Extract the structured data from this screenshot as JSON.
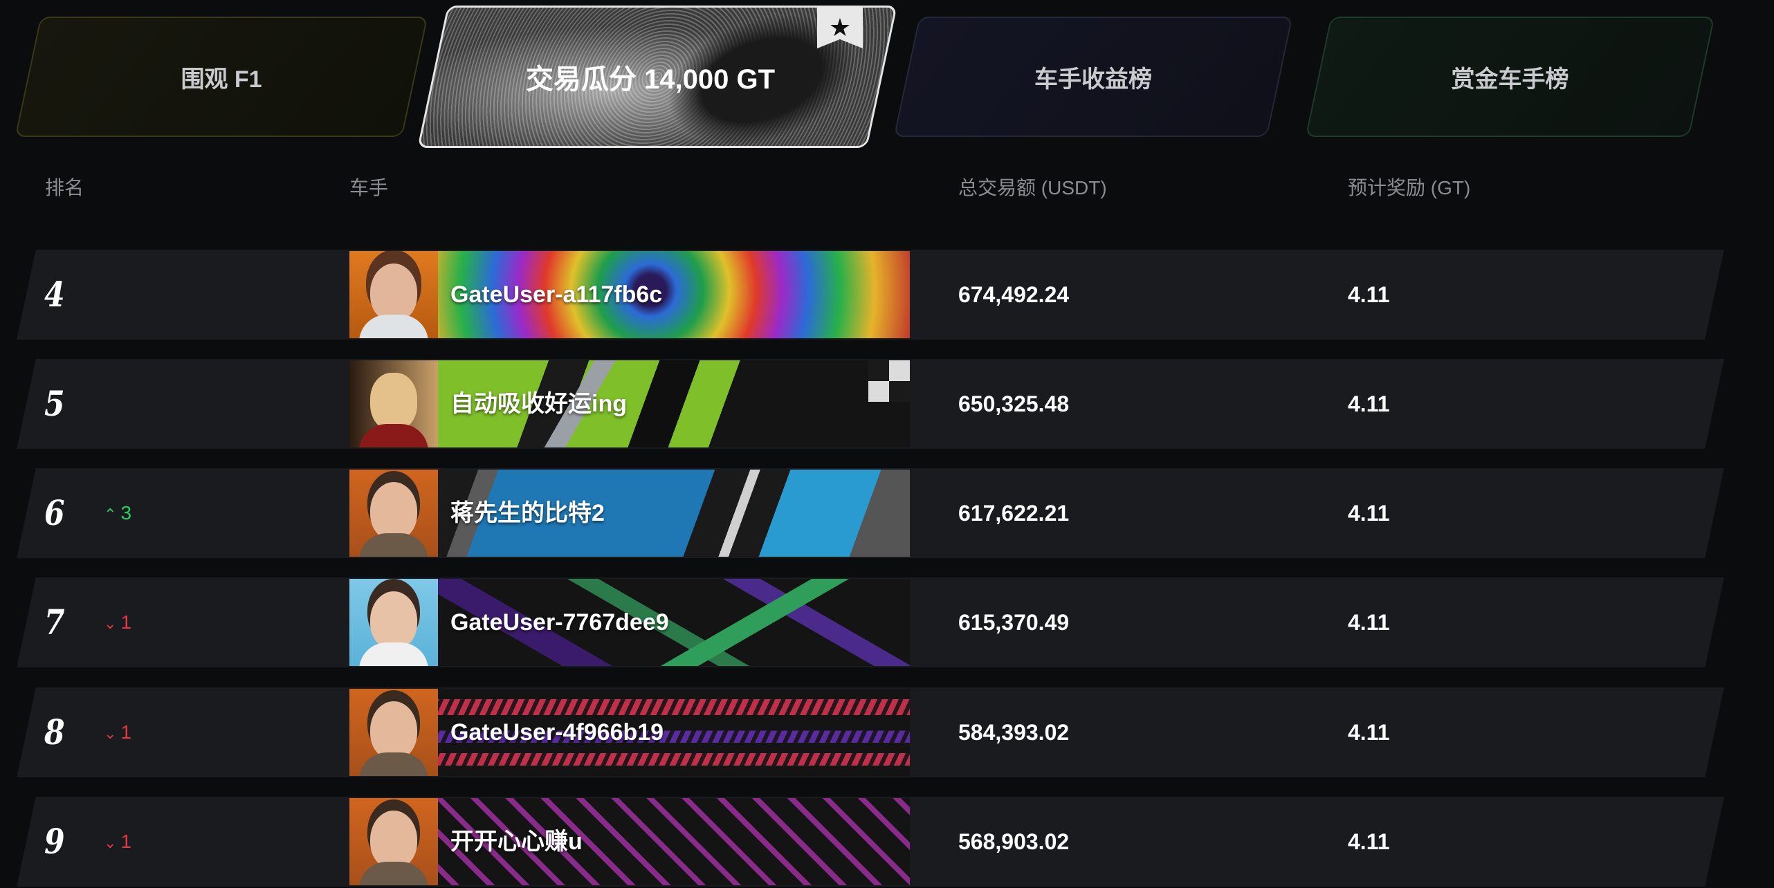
{
  "tabs": [
    {
      "label": "围观 F1"
    },
    {
      "label": "交易瓜分 14,000 GT"
    },
    {
      "label": "车手收益榜"
    },
    {
      "label": "赏金车手榜"
    }
  ],
  "header": {
    "rank": "排名",
    "driver": "车手",
    "total_volume": "总交易额 (USDT)",
    "reward": "预计奖励 (GT)"
  },
  "rows": [
    {
      "rank": "4",
      "change": "",
      "name": "GateUser-a117fb6c",
      "amount": "674,492.24",
      "reward": "4.11"
    },
    {
      "rank": "5",
      "change": "",
      "name": "自动吸收好运ing",
      "amount": "650,325.48",
      "reward": "4.11"
    },
    {
      "rank": "6",
      "change": "3",
      "name": "蒋先生的比特2",
      "amount": "617,622.21",
      "reward": "4.11"
    },
    {
      "rank": "7",
      "change": "1",
      "name": "GateUser-7767dee9",
      "amount": "615,370.49",
      "reward": "4.11"
    },
    {
      "rank": "8",
      "change": "1",
      "name": "GateUser-4f966b19",
      "amount": "584,393.02",
      "reward": "4.11"
    },
    {
      "rank": "9",
      "change": "1",
      "name": "开开心心赚u",
      "amount": "568,903.02",
      "reward": "4.11"
    }
  ],
  "change_directions": [
    "none",
    "none",
    "up",
    "down",
    "down",
    "down"
  ],
  "colors": {
    "up": "#27d05a",
    "down": "#e23745",
    "row_bg": "#191b1f",
    "page_bg": "#0b0c0e"
  },
  "icons": {
    "up": "chevron-up-icon",
    "down": "chevron-down-icon",
    "badge": "star-icon"
  }
}
